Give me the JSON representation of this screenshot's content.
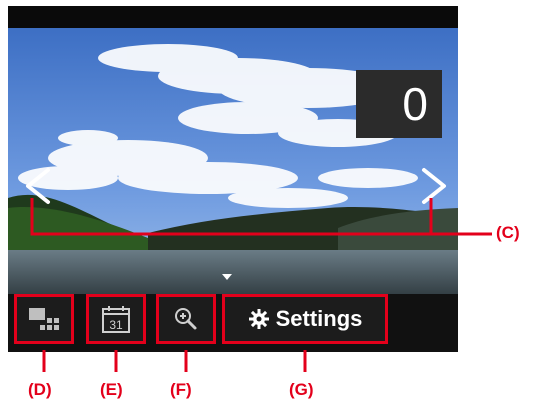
{
  "counter": {
    "value": "0"
  },
  "nav": {
    "prev_icon": "chevron-left-icon",
    "next_icon": "chevron-right-icon"
  },
  "buttons": {
    "D": {
      "icon": "thumbnail-view-icon"
    },
    "E": {
      "icon": "calendar-icon",
      "calendar_day": "31"
    },
    "F": {
      "icon": "zoom-in-icon"
    },
    "G": {
      "icon": "gear-icon",
      "label": "Settings"
    }
  },
  "callouts": [
    "(C)",
    "(D)",
    "(E)",
    "(F)",
    "(G)"
  ],
  "colors": {
    "callout": "#e3001b",
    "screen_bg": "#1a1a1a",
    "text": "#ffffff"
  }
}
